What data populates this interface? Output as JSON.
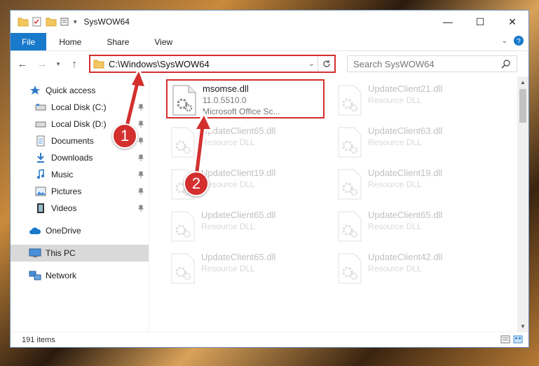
{
  "window": {
    "title": "SysWOW64"
  },
  "window_controls": {
    "minimize": "—",
    "maximize": "☐",
    "close": "✕"
  },
  "ribbon": {
    "tabs": [
      "File",
      "Home",
      "Share",
      "View"
    ]
  },
  "address": {
    "path": "C:\\Windows\\SysWOW64"
  },
  "search": {
    "placeholder": "Search SysWOW64"
  },
  "nav": {
    "quick_access": "Quick access",
    "items": [
      "Local Disk (C:)",
      "Local Disk (D:)",
      "Documents",
      "Downloads",
      "Music",
      "Pictures",
      "Videos"
    ],
    "onedrive": "OneDrive",
    "this_pc": "This PC",
    "network": "Network"
  },
  "files": [
    {
      "name": "msomse.dll",
      "line1": "11.0.5510.0",
      "line2": "Microsoft Office Sc..."
    },
    {
      "name": "UpdateClient21.dll",
      "line1": "Resource DLL"
    },
    {
      "name": "UpdateClient65.dll",
      "line1": "Resource DLL"
    },
    {
      "name": "UpdateClient63.dll",
      "line1": "Resource DLL"
    },
    {
      "name": "UpdateClient19.dll",
      "line1": "Resource DLL"
    },
    {
      "name": "UpdateClient19.dll",
      "line1": "Resource DLL"
    },
    {
      "name": "UpdateClient65.dll",
      "line1": "Resource DLL"
    },
    {
      "name": "UpdateClient65.dll",
      "line1": "Resource DLL"
    },
    {
      "name": "UpdateClient65.dll",
      "line1": "Resource DLL"
    },
    {
      "name": "UpdateClient42.dll",
      "line1": "Resource DLL"
    }
  ],
  "status": {
    "count": "191 items"
  },
  "callouts": [
    "1",
    "2"
  ],
  "colors": {
    "accent": "#1979ca",
    "highlight": "#d32f2f"
  }
}
